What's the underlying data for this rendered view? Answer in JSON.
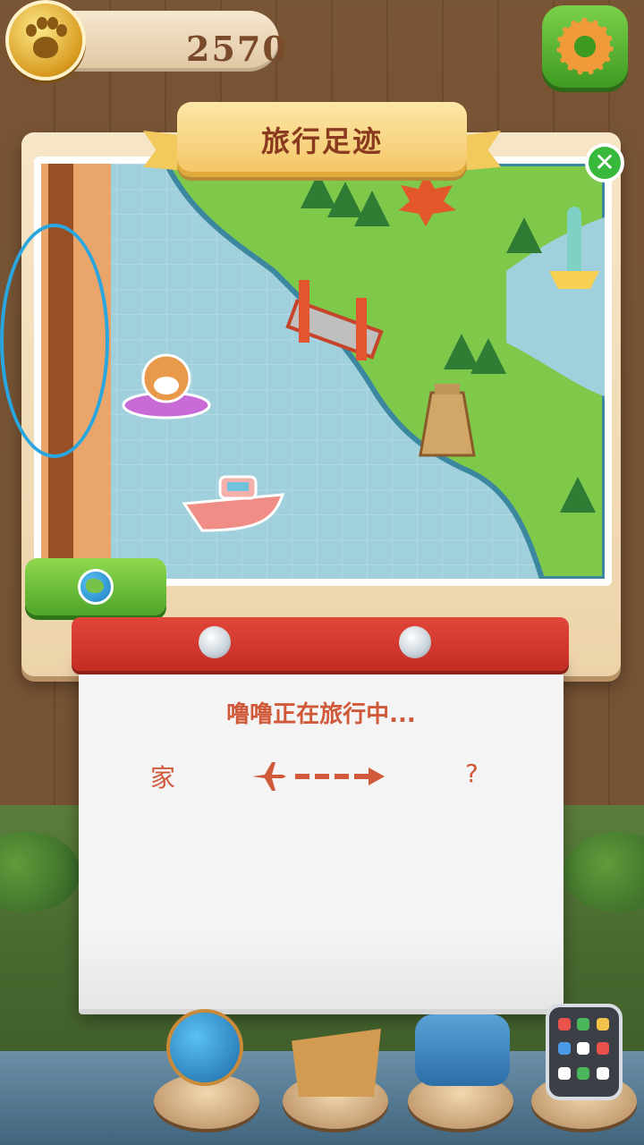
{
  "hud": {
    "coins": "2570",
    "coin_icon": "paw-coin-icon",
    "settings_icon": "gear-icon"
  },
  "panel": {
    "title": "旅行足迹",
    "close_icon": "close-icon",
    "globe_button_icon": "globe-icon"
  },
  "travel": {
    "status": "噜噜正在旅行中...",
    "from": "家",
    "to": "?",
    "plane_icon": "plane-icon",
    "arrow_icon": "dashed-arrow-icon"
  },
  "tray": {
    "items": [
      "globe-icon",
      "toolbox-icon",
      "telephone-icon",
      "tablet-icon"
    ]
  },
  "colors": {
    "accent_text": "#d0593a",
    "title_text": "#8a3a1e",
    "green_button": "#4fa52a",
    "red_bar": "#c42d24"
  }
}
